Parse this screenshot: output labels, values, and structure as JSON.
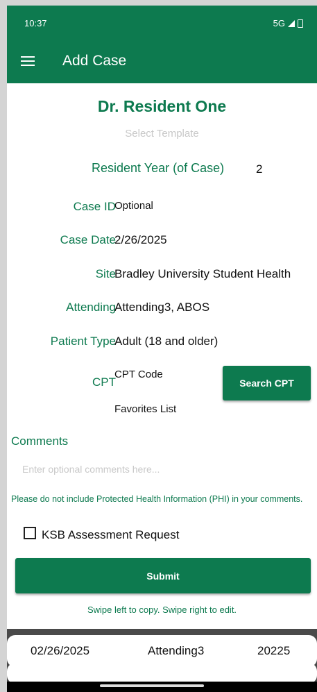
{
  "status": {
    "time": "10:37",
    "network": "5G"
  },
  "header": {
    "title": "Add Case"
  },
  "form": {
    "resident_name": "Dr. Resident One",
    "template_placeholder": "Select Template",
    "resident_year_label": "Resident Year (of Case)",
    "resident_year_value": "2",
    "case_id_label": "Case ID",
    "case_id_placeholder": "Optional",
    "case_date_label": "Case Date",
    "case_date_value": "2/26/2025",
    "site_label": "Site",
    "site_value": "Bradley University Student Health",
    "attending_label": "Attending",
    "attending_value": "Attending3, ABOS",
    "patient_type_label": "Patient Type",
    "patient_type_value": "Adult (18 and older)",
    "cpt_label": "CPT",
    "cpt_placeholder": "CPT Code",
    "search_cpt_label": "Search CPT",
    "favorites_placeholder": "Favorites List",
    "comments_label": "Comments",
    "comments_placeholder": "Enter optional comments here...",
    "phi_notice": "Please do not include Protected Health Information (PHI) in your comments.",
    "ksb_label": "KSB Assessment Request",
    "ksb_checked": false,
    "submit_label": "Submit",
    "swipe_hint": "Swipe left to copy. Swipe right to edit."
  },
  "cases": [
    {
      "date": "02/26/2025",
      "attending": "Attending3",
      "code": "20225"
    }
  ],
  "colors": {
    "accent": "#0d7a4f",
    "placeholder": "#c8c8c8"
  }
}
